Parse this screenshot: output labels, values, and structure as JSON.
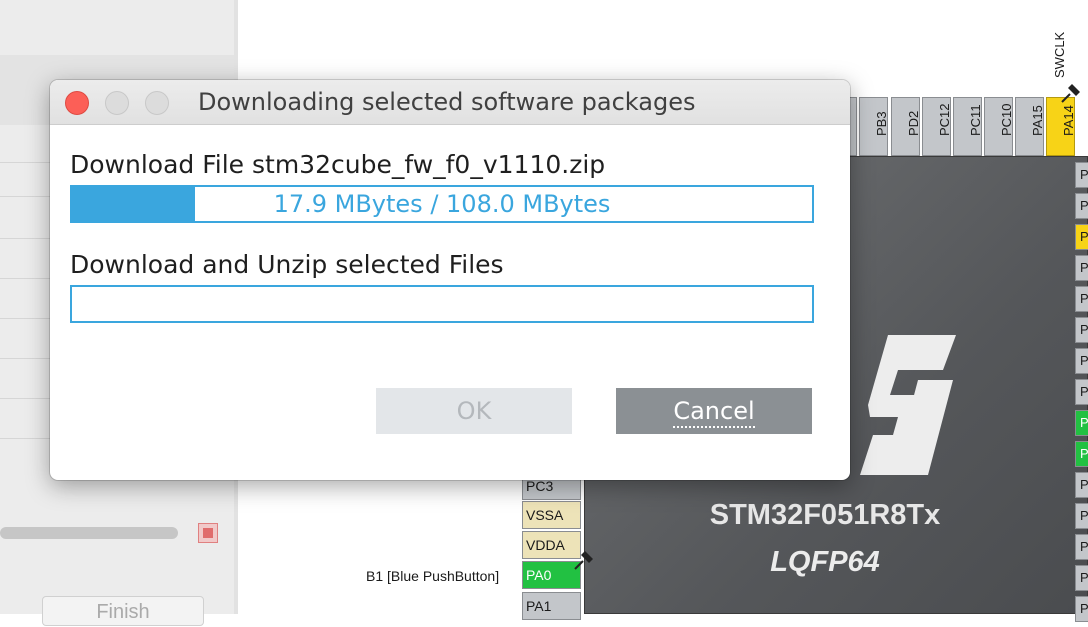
{
  "background": {
    "left_panel": {
      "finish_label": "Finish"
    },
    "pinout": {
      "top_pins": [
        "PB3",
        "PD2",
        "PC12",
        "PC11",
        "PC10",
        "PA15",
        "PA14"
      ],
      "swclk_label": "SWCLK",
      "left_pins": [
        "PC3",
        "VSSA",
        "VDDA",
        "PA0",
        "PA1"
      ],
      "right_pins": [
        "P",
        "P",
        "P",
        "P",
        "P",
        "P",
        "P",
        "P",
        "P",
        "P",
        "P",
        "P",
        "P",
        "P",
        "P",
        "P",
        "P",
        "P"
      ],
      "b1_label": "B1 [Blue PushButton]",
      "chip_name": "STM32F051R8Tx",
      "chip_package": "LQFP64",
      "colors": {
        "assigned_pin": "#22c142",
        "debug_pin": "#f7d317",
        "default_pin": "#c3c6ca",
        "power_pin": "#ede3b8"
      }
    }
  },
  "dialog": {
    "title": "Downloading selected software packages",
    "download_file_label": "Download File stm32cube_fw_f0_v1110.zip",
    "download_progress": {
      "text": "17.9 MBytes  /  108.0 MBytes",
      "fraction": 0.1657
    },
    "unzip_label": "Download and Unzip selected Files",
    "unzip_progress": {
      "text": "",
      "fraction": 0
    },
    "ok_label": "OK",
    "cancel_label": "Cancel",
    "accent_color": "#3aa6de"
  }
}
